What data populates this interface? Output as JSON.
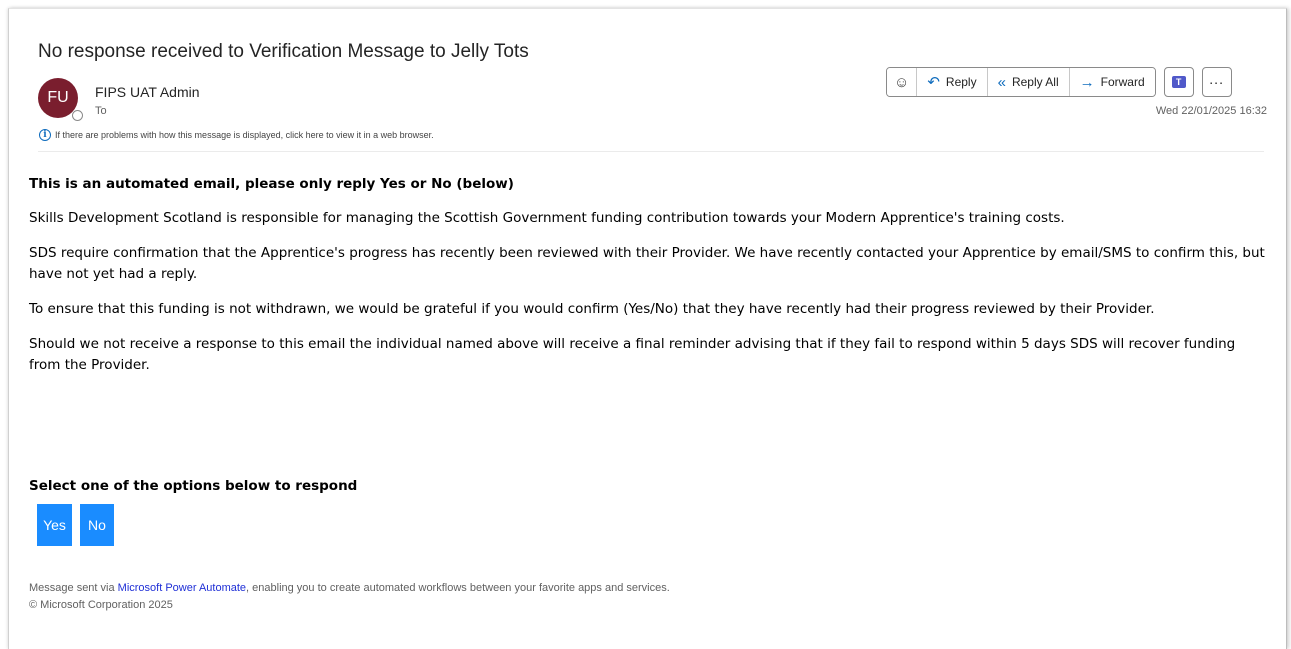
{
  "email": {
    "subject": "No response received to Verification Message to Jelly Tots",
    "sender_initials": "FU",
    "sender_name": "FIPS UAT Admin",
    "to_label": "To",
    "info_notice": "If there are problems with how this message is displayed, click here to view it in a web browser.",
    "date": "Wed 22/01/2025 16:32",
    "avatar_color": "#7a1e2e"
  },
  "toolbar": {
    "reply_label": "Reply",
    "reply_all_label": "Reply All",
    "forward_label": "Forward",
    "teams_letter": "T",
    "more_label": "..."
  },
  "body": {
    "heading": "This is an automated email, please only reply Yes or No (below)",
    "paragraphs": [
      "Skills Development Scotland is responsible for managing the Scottish Government funding contribution towards your Modern Apprentice's training costs.",
      "SDS require confirmation that the Apprentice's progress has recently been reviewed with their Provider. We have recently contacted your Apprentice by email/SMS to confirm this, but have not yet had a reply.",
      "To ensure that this funding is not withdrawn, we would be grateful if you would confirm (Yes/No) that they have recently had their progress reviewed by their Provider.",
      "Should we not receive a response to this email the individual named above will receive a final reminder advising that if they fail to respond within 5 days SDS will recover funding from the Provider."
    ],
    "respond_prompt": "Select one of the options below to respond",
    "yes_label": "Yes",
    "no_label": "No",
    "button_color": "#1a8cff"
  },
  "footer": {
    "prefix": "Message sent via ",
    "link_text": "Microsoft Power Automate",
    "suffix": ", enabling you to create automated workflows between your favorite apps and services.",
    "copyright": "© Microsoft Corporation 2025"
  }
}
